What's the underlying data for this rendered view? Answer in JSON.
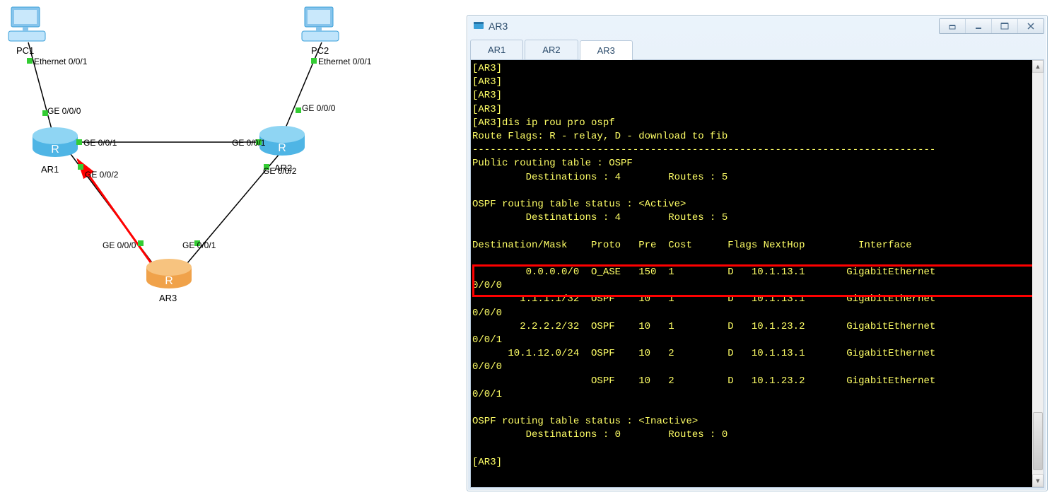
{
  "topology": {
    "devices": {
      "pc1": {
        "label": "PC1"
      },
      "pc2": {
        "label": "PC2"
      },
      "ar1": {
        "label": "AR1"
      },
      "ar2": {
        "label": "AR2"
      },
      "ar3": {
        "label": "AR3"
      }
    },
    "ports": {
      "pc1_eth": "Ethernet 0/0/1",
      "pc2_eth": "Ethernet 0/0/1",
      "ar1_ge0": "GE 0/0/0",
      "ar1_ge1": "GE 0/0/1",
      "ar1_ge2": "GE 0/0/2",
      "ar2_ge0": "GE 0/0/0",
      "ar2_ge1": "GE 0/0/1",
      "ar2_ge2": "GE 0/0/2",
      "ar3_ge0": "GE 0/0/0",
      "ar3_ge1": "GE 0/0/1"
    }
  },
  "window": {
    "title": "AR3",
    "tabs": [
      "AR1",
      "AR2",
      "AR3"
    ],
    "active_tab": "AR3"
  },
  "terminal": {
    "command": "dis ip rou pro ospf",
    "prompt_lines": [
      "[AR3]",
      "[AR3]",
      "[AR3]",
      "[AR3]"
    ],
    "flags_legend": "Route Flags: R - relay, D - download to fib",
    "separator": "------------------------------------------------------------------------------",
    "public_title": "Public routing table : OSPF",
    "public_counts": "         Destinations : 4        Routes : 5",
    "active_title": "OSPF routing table status : <Active>",
    "active_counts": "         Destinations : 4        Routes : 5",
    "header": "Destination/Mask    Proto   Pre  Cost      Flags NextHop         Interface",
    "routes": [
      {
        "dest": "0.0.0.0/0",
        "proto": "O_ASE",
        "pre": "150",
        "cost": "1",
        "flags": "D",
        "nexthop": "10.1.13.1",
        "iface_line": "GigabitEthernet",
        "iface_cont": "0/0/0",
        "highlight": true
      },
      {
        "dest": "1.1.1.1/32",
        "proto": "OSPF",
        "pre": "10",
        "cost": "1",
        "flags": "D",
        "nexthop": "10.1.13.1",
        "iface_line": "GigabitEthernet",
        "iface_cont": "0/0/0"
      },
      {
        "dest": "2.2.2.2/32",
        "proto": "OSPF",
        "pre": "10",
        "cost": "1",
        "flags": "D",
        "nexthop": "10.1.23.2",
        "iface_line": "GigabitEthernet",
        "iface_cont": "0/0/1"
      },
      {
        "dest": "10.1.12.0/24",
        "proto": "OSPF",
        "pre": "10",
        "cost": "2",
        "flags": "D",
        "nexthop": "10.1.13.1",
        "iface_line": "GigabitEthernet",
        "iface_cont": "0/0/0"
      },
      {
        "dest": "",
        "proto": "OSPF",
        "pre": "10",
        "cost": "2",
        "flags": "D",
        "nexthop": "10.1.23.2",
        "iface_line": "GigabitEthernet",
        "iface_cont": "0/0/1"
      }
    ],
    "inactive_title": "OSPF routing table status : <Inactive>",
    "inactive_counts": "         Destinations : 0        Routes : 0",
    "end_prompt": "[AR3]"
  }
}
